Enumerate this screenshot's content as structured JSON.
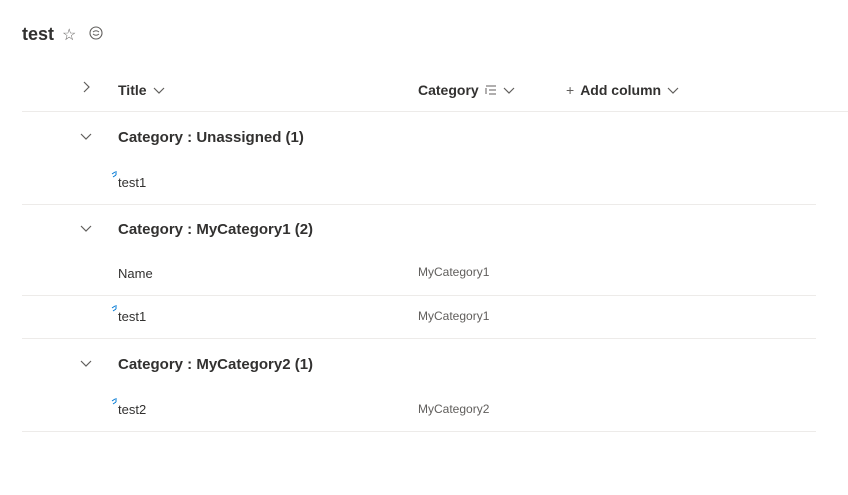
{
  "page": {
    "title": "test"
  },
  "columns": {
    "title": "Title",
    "category": "Category",
    "add_column": "Add column"
  },
  "groups": [
    {
      "label": "Category : Unassigned (1)",
      "rows": [
        {
          "title": "test1",
          "category": "",
          "new": true
        }
      ]
    },
    {
      "label": "Category : MyCategory1 (2)",
      "rows": [
        {
          "title": "Name",
          "category": "MyCategory1",
          "new": false
        },
        {
          "title": "test1",
          "category": "MyCategory1",
          "new": true
        }
      ]
    },
    {
      "label": "Category : MyCategory2 (1)",
      "rows": [
        {
          "title": "test2",
          "category": "MyCategory2",
          "new": true
        }
      ]
    }
  ],
  "colors": {
    "text": "#323130",
    "muted": "#605e5c",
    "divider": "#edebe9",
    "new_indicator": "#0078d4"
  }
}
